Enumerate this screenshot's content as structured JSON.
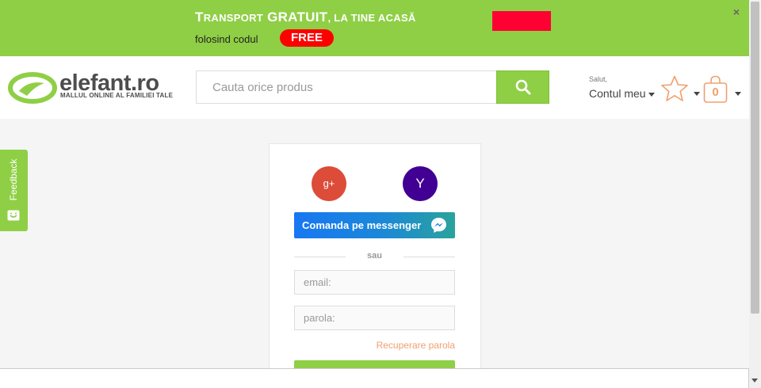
{
  "promo": {
    "title_cap_t": "T",
    "title_ransport": "RANSPORT",
    "title_gratuit": "GRATUIT",
    "title_rest": ", LA TINE ACASĂ",
    "subtitle": "folosind codul",
    "code": "FREE",
    "close": "×"
  },
  "header": {
    "logo_name": "elefant.ro",
    "logo_tagline": "MALLUL ONLINE AL FAMILIEI TALE",
    "search_placeholder": "Cauta orice produs",
    "account_greeting": "Salut,",
    "account_label": "Contul meu",
    "cart_count": "0"
  },
  "feedback": {
    "label": "Feedback"
  },
  "login": {
    "google_label": "g+",
    "yahoo_label": "Y",
    "messenger_label": "Comanda pe messenger",
    "divider": "sau",
    "email_placeholder": "email:",
    "password_placeholder": "parola:",
    "recover_link": "Recuperare parola"
  },
  "colors": {
    "brand_green": "#8fcf45",
    "promo_red": "#ff0000",
    "google_red": "#dd4b39",
    "yahoo_purple": "#410093",
    "accent_orange": "#f0a070"
  },
  "icons": [
    "close-icon",
    "logo-icon",
    "search-icon",
    "star-icon",
    "bag-icon",
    "feedback-icon",
    "messenger-icon",
    "caret-down-icon"
  ]
}
